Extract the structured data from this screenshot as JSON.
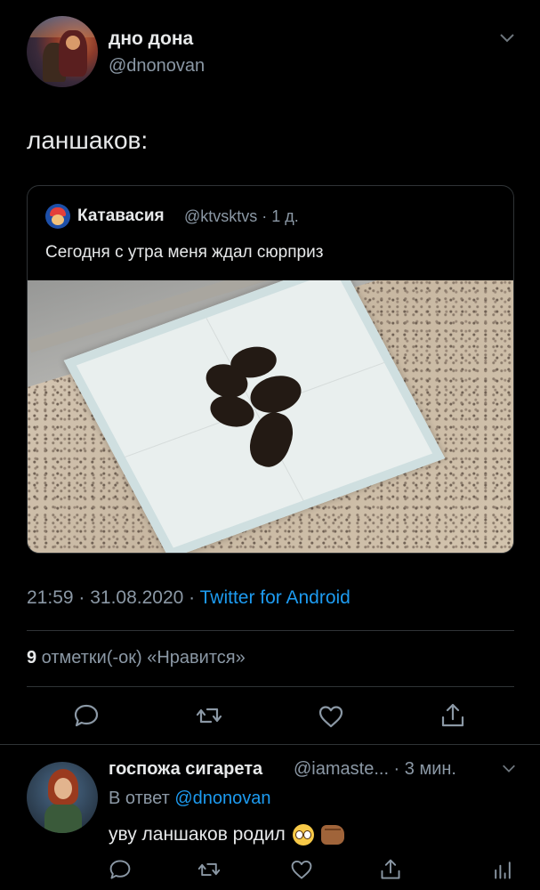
{
  "main_tweet": {
    "author_name": "дно дона",
    "author_handle": "@dnonovan",
    "text": "ланшаков:",
    "timestamp": "21:59 · 31.08.2020 · ",
    "source": "Twitter for Android",
    "likes_count": "9",
    "likes_label": " отметки(-ок) «Нравится»"
  },
  "quoted_tweet": {
    "author_name": "Катавасия",
    "author_handle_time": "@ktvsktvs · 1 д.",
    "text": "Сегодня с утра меня ждал сюрприз"
  },
  "actions": {
    "reply_icon": "comment-icon",
    "retweet_icon": "retweet-icon",
    "like_icon": "heart-icon",
    "share_icon": "share-icon"
  },
  "reply": {
    "author_name": "госпожа сигарета",
    "author_meta": "@iamaste... · 3 мин.",
    "reply_to_prefix": "В ответ ",
    "reply_to_handle": "@dnonovan",
    "text": "уву ланшаков родил"
  },
  "colors": {
    "background": "#000000",
    "text": "#e7e9ea",
    "secondary": "#8b98a5",
    "accent": "#1d9bf0",
    "border": "#2f3336"
  }
}
